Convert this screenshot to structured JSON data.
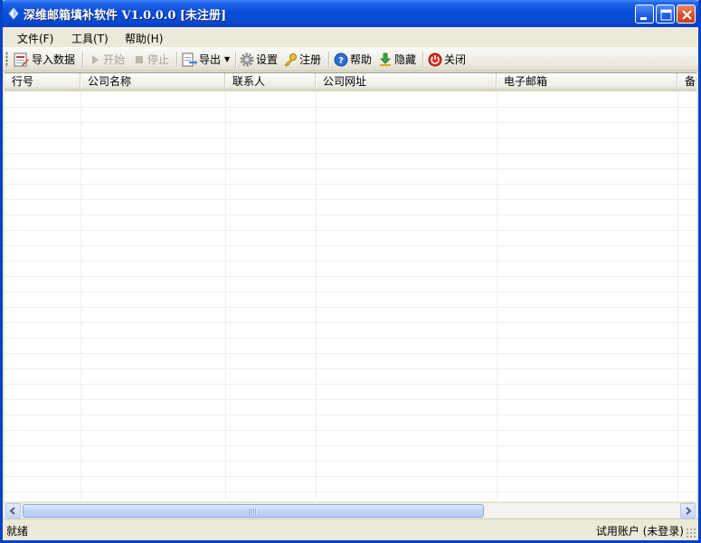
{
  "window": {
    "title": "深维邮箱填补软件 V1.0.0.0 [未注册]"
  },
  "menu": {
    "items": [
      "文件(F)",
      "工具(T)",
      "帮助(H)"
    ]
  },
  "toolbar": {
    "import": "导入数据",
    "start": "开始",
    "stop": "停止",
    "export": "导出",
    "settings": "设置",
    "register": "注册",
    "help": "帮助",
    "hide": "隐藏",
    "close": "关闭"
  },
  "grid": {
    "columns": [
      "行号",
      "公司名称",
      "联系人",
      "公司网址",
      "电子邮箱",
      "备注"
    ]
  },
  "status": {
    "left": "就绪",
    "right": "试用账户 (未登录)"
  },
  "colors": {
    "titlebar": "#0a4ed8",
    "window_border": "#0842c6",
    "chrome": "#ece9d8"
  },
  "icons": [
    "app-icon",
    "minimize-icon",
    "maximize-icon",
    "close-icon",
    "import-icon",
    "play-icon",
    "stop-icon",
    "export-icon",
    "gear-icon",
    "key-icon",
    "help-icon",
    "download-icon",
    "power-icon"
  ]
}
